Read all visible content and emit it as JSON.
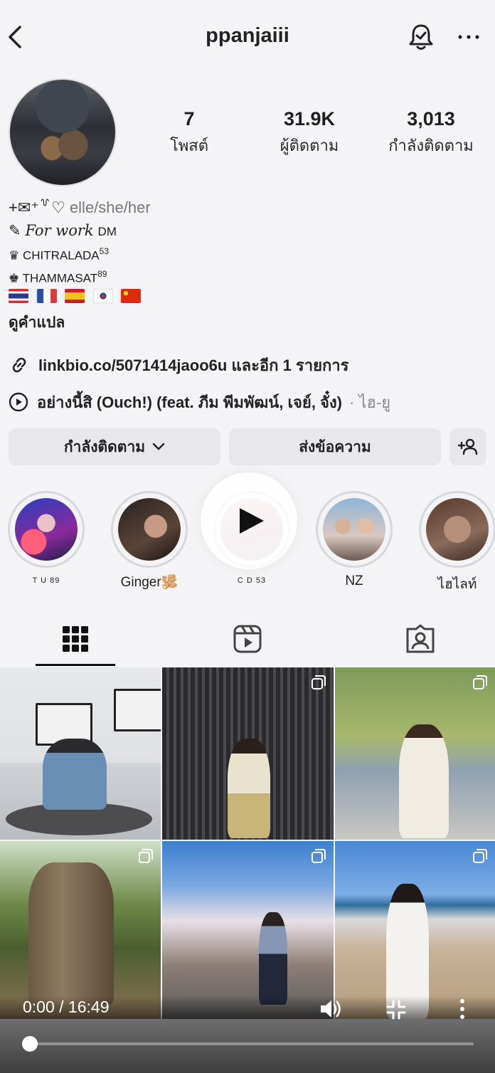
{
  "header": {
    "username": "ppanjaiii"
  },
  "stats": [
    {
      "value": "7",
      "label": "โพสต์"
    },
    {
      "value": "31.9K",
      "label": "ผู้ติดตาม"
    },
    {
      "value": "3,013",
      "label": "กำลังติดตาม"
    }
  ],
  "bio": {
    "pronoun_prefix": "+✉⁺꒷♡",
    "pronouns": "elle/she/her",
    "work_prefix": "✎",
    "work_text": "For work",
    "work_dm": "DM",
    "school1": "♛ CHITRALADA",
    "school1_sup": "53",
    "school2": "♚ THAMMASAT",
    "school2_sup": "89",
    "translate": "ดูคำแปล"
  },
  "link": {
    "text": "linkbio.co/5071414jaoo6u และอีก 1 รายการ"
  },
  "music": {
    "title": "อย่างนี้สิ (Ouch!) (feat. ภีม พีมพัฒน์, เจย์, จั๋ง)",
    "artist": "· ไฮ-ยู"
  },
  "buttons": {
    "following": "กำลังติดตาม",
    "message": "ส่งข้อความ"
  },
  "highlights": [
    {
      "label": "T U 89"
    },
    {
      "label": "Ginger🫚"
    },
    {
      "label": "C D 53"
    },
    {
      "label": "NZ"
    },
    {
      "label": "ไฮไลท์"
    }
  ],
  "video": {
    "time": "0:00 / 16:49",
    "progress": 0.0
  }
}
